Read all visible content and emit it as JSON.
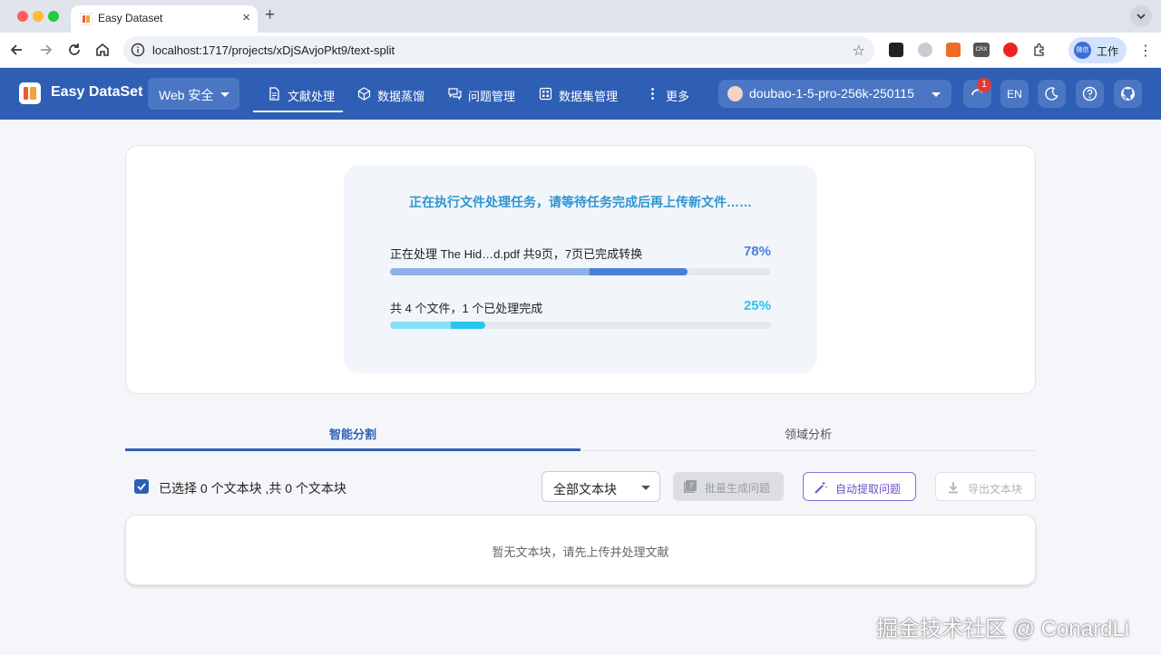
{
  "browser": {
    "tab_title": "Easy Dataset",
    "new_tab": "+",
    "close": "×",
    "url": "localhost:1717/projects/xDjSAvjoPkt9/text-split",
    "star": "☆",
    "profile_avatar": "微信",
    "profile_label": "工作",
    "ext_crx": "CRX",
    "menu": "⋮"
  },
  "app": {
    "brand": "Easy DataSet",
    "project": "Web 安全",
    "nav": [
      {
        "label": "文献处理",
        "icon": "document-icon",
        "active": true
      },
      {
        "label": "数据蒸馏",
        "icon": "cube-icon"
      },
      {
        "label": "问题管理",
        "icon": "chat-icon"
      },
      {
        "label": "数据集管理",
        "icon": "dataset-icon"
      },
      {
        "label": "更多",
        "icon": "more-vertical-icon"
      }
    ],
    "model": "doubao-1-5-pro-256k-250115",
    "notification_count": "1",
    "lang": "EN"
  },
  "progress": {
    "message": "正在执行文件处理任务，请等待任务完成后再上传新文件……",
    "file_status": "正在处理 The Hid…d.pdf 共9页，7页已完成转换",
    "file_percent_label": "78%",
    "file_progress": 0.78,
    "overall_status": "共 4 个文件，1 个已处理完成",
    "overall_percent_label": "25%",
    "overall_progress": 0.25
  },
  "tabs": [
    "智能分割",
    "领域分析"
  ],
  "actions": {
    "selection_text": "已选择 0 个文本块 ,共 0 个文本块",
    "filter_value": "全部文本块",
    "batch_generate": "批量生成问题",
    "auto_extract": "自动提取问题",
    "export": "导出文本块"
  },
  "empty_message": "暂无文本块，请先上传并处理文献",
  "watermark": "掘金技术社区 @ ConardLi",
  "colors": {
    "header": "#2f5fb4",
    "progress_file": "#4a7fd6",
    "progress_overall": "#26c6ef",
    "accent_purple": "#6e4fcb"
  }
}
